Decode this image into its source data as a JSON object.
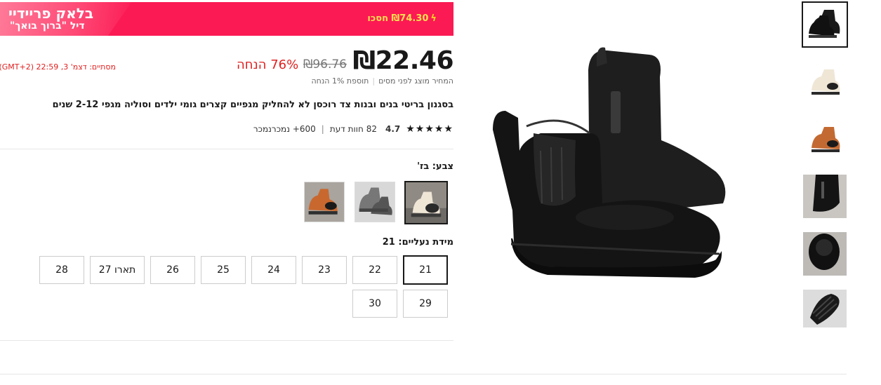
{
  "banner": {
    "title": "בלאק פריידיי",
    "subtitle": "דיל \"ברוך בואך\"",
    "save_text": "₪74.30 חסכו",
    "flash_icon": "lightning-icon"
  },
  "price": {
    "current": "₪22.46",
    "original": "₪96.76",
    "discount": "76% הנחה",
    "ends": "מסתיים:  דצמ' 3, 22:59 (GMT+2)",
    "tax_note": "המחיר מוצג לפני מסים",
    "extra_discount": "תוספת 1% הנחה"
  },
  "product": {
    "title": "בסגנון בריטי בנים ובנות צד רוכסן לא להחליק מגפיים קצרים גומי ילדים וסוליה מגפי 2-12 שנים",
    "rating": "4.7",
    "stars": "★★★★★",
    "reviews": "82 חוות דעת",
    "sold": "600+ נמכרנמכר"
  },
  "color": {
    "label": "צבע: בז'",
    "options": [
      "black",
      "beige",
      "brown"
    ]
  },
  "size": {
    "label": "מידת נעליים: 21",
    "options": [
      "21",
      "22",
      "23",
      "24",
      "25",
      "26",
      "27 תארו",
      "28",
      "29",
      "30"
    ],
    "selected": "21"
  },
  "gallery": {
    "thumbs": [
      "black-boot",
      "beige-boot",
      "brown-boot",
      "boot-closeup",
      "boot-top-view",
      "boot-sole"
    ]
  },
  "colors": {
    "banner": "#fb1a54",
    "accent_red": "#e02020",
    "save_yellow": "#ffe14d"
  }
}
